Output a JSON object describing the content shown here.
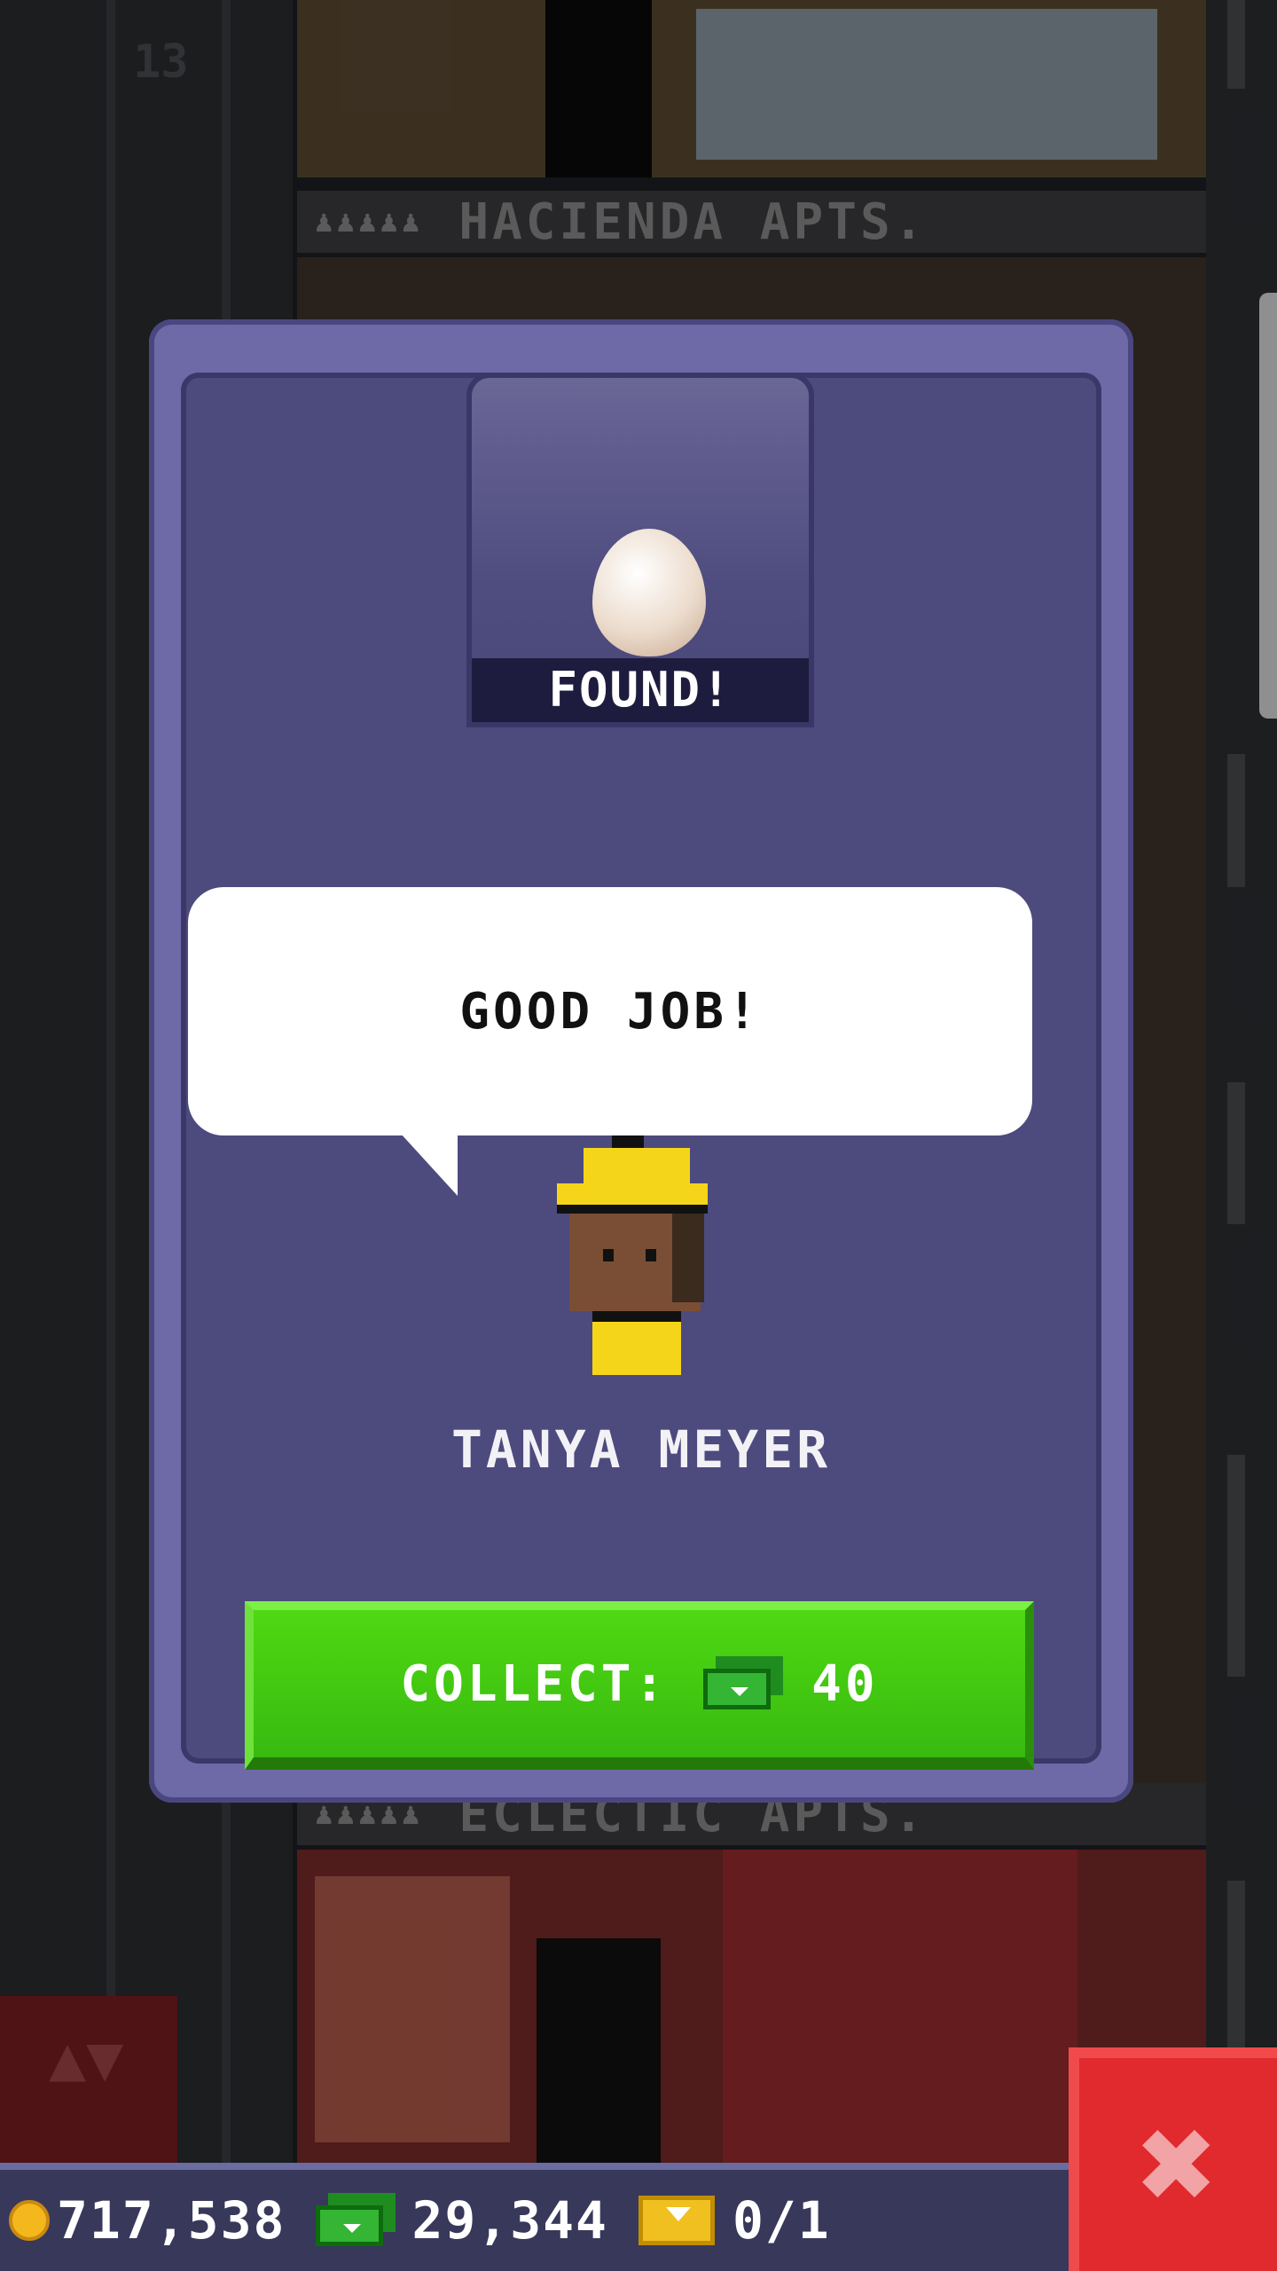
{
  "background": {
    "floor_number": "13",
    "upper_floor_sign": "HACIENDA APTS.",
    "lower_floor_sign": "ECLECTIC APTS.",
    "people_icons": "♟♟♟♟♟"
  },
  "dialog": {
    "found_label": "FOUND!",
    "found_item_icon": "egg-icon",
    "speech": "GOOD JOB!",
    "character_name": "TANYA MEYER",
    "collect_label": "COLLECT:",
    "collect_reward_icon": "bux-icon",
    "collect_amount": "40"
  },
  "status_bar": {
    "coins": "717,538",
    "bux": "29,344",
    "tickets": "0/1"
  },
  "controls": {
    "close_symbol": "✖",
    "elevator_symbol": "▲▼"
  },
  "colors": {
    "dialog_frame": "#6e6aa8",
    "dialog_inner": "#4d4a7e",
    "collect_button": "#4fd812",
    "close_button": "#e02a2e",
    "status_bar": "#37385a"
  }
}
